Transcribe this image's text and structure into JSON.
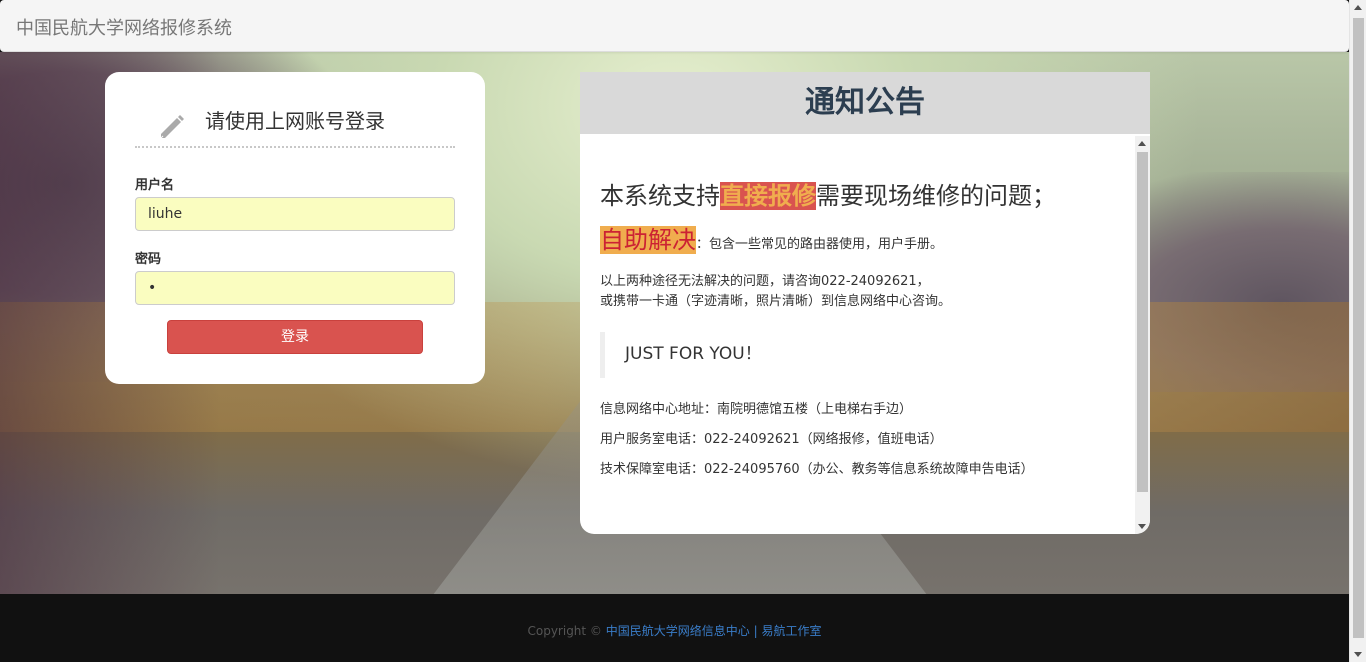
{
  "navbar": {
    "brand": "中国民航大学网络报修系统"
  },
  "login": {
    "title": "请使用上网账号登录",
    "username_label": "用户名",
    "username_value": "liuhe",
    "password_label": "密码",
    "password_value": "•",
    "submit_label": "登录"
  },
  "notice": {
    "title": "通知公告",
    "line1_prefix": "本系统支持",
    "line1_highlight": "直接报修",
    "line1_suffix": "需要现场维修的问题；",
    "line2_highlight": "自助解决",
    "line2_suffix": "：包含一些常见的路由器使用，用户手册。",
    "para_line1": "以上两种途径无法解决的问题，请咨询022-24092621，",
    "para_line2": "或携带一卡通（字迹清晰，照片清晰）到信息网络中心咨询。",
    "quote": "JUST FOR  YOU！",
    "address": "信息网络中心地址：南院明德馆五楼（上电梯右手边）",
    "service_phone": "用户服务室电话：022-24092621（网络报修，值班电话）",
    "support_phone": "技术保障室电话：022-24095760（办公、教务等信息系统故障申告电话）"
  },
  "footer": {
    "copyright": "Copyright ©",
    "link1": "中国民航大学网络信息中心",
    "separator": "|",
    "link2": "易航工作室"
  },
  "colors": {
    "danger": "#d9534f",
    "warning": "#f0ad4e",
    "input_autofill": "#fafdc0",
    "link": "#3a7dc9"
  }
}
